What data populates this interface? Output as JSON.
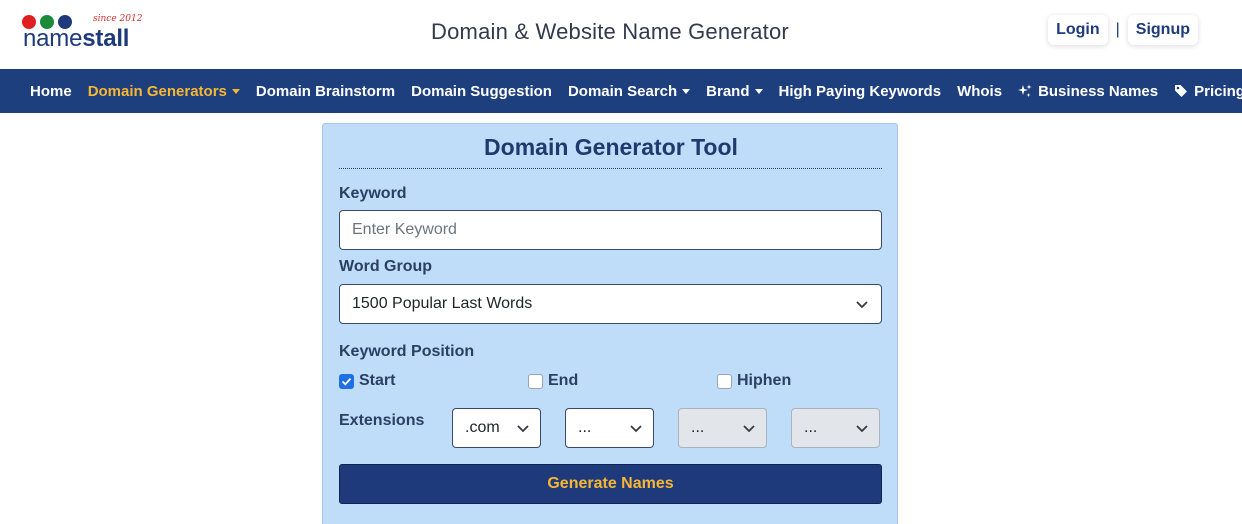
{
  "logo": {
    "name_part": "name",
    "stall_part": "stall",
    "since": "since 2012",
    "dot_colors": [
      "#e02020",
      "#1b8a3a",
      "#1e3a7b"
    ]
  },
  "header": {
    "title": "Domain & Website Name Generator",
    "login_label": "Login",
    "separator": "|",
    "signup_label": "Signup"
  },
  "nav": {
    "items": [
      {
        "label": "Home"
      },
      {
        "label": "Domain Generators"
      },
      {
        "label": "Domain Brainstorm"
      },
      {
        "label": "Domain Suggestion"
      },
      {
        "label": "Domain Search"
      },
      {
        "label": "Brand"
      },
      {
        "label": "High Paying Keywords"
      },
      {
        "label": "Whois"
      },
      {
        "label": "Business Names"
      },
      {
        "label": "Pricing"
      }
    ]
  },
  "tool": {
    "title": "Domain Generator Tool",
    "keyword_label": "Keyword",
    "keyword_placeholder": "Enter Keyword",
    "word_group_label": "Word Group",
    "word_group_value": "1500 Popular Last Words",
    "position_label": "Keyword Position",
    "positions": [
      {
        "label": "Start",
        "checked": true
      },
      {
        "label": "End",
        "checked": false
      },
      {
        "label": "Hiphen",
        "checked": false
      }
    ],
    "extensions_label": "Extensions",
    "extensions": [
      ".com",
      "...",
      "...",
      "..."
    ],
    "generate_label": "Generate Names"
  },
  "colors": {
    "navbar": "#1e3f7d",
    "accent": "#f7b733",
    "card_bg": "#bfdcf8",
    "brand_blue": "#1e3a7b"
  }
}
